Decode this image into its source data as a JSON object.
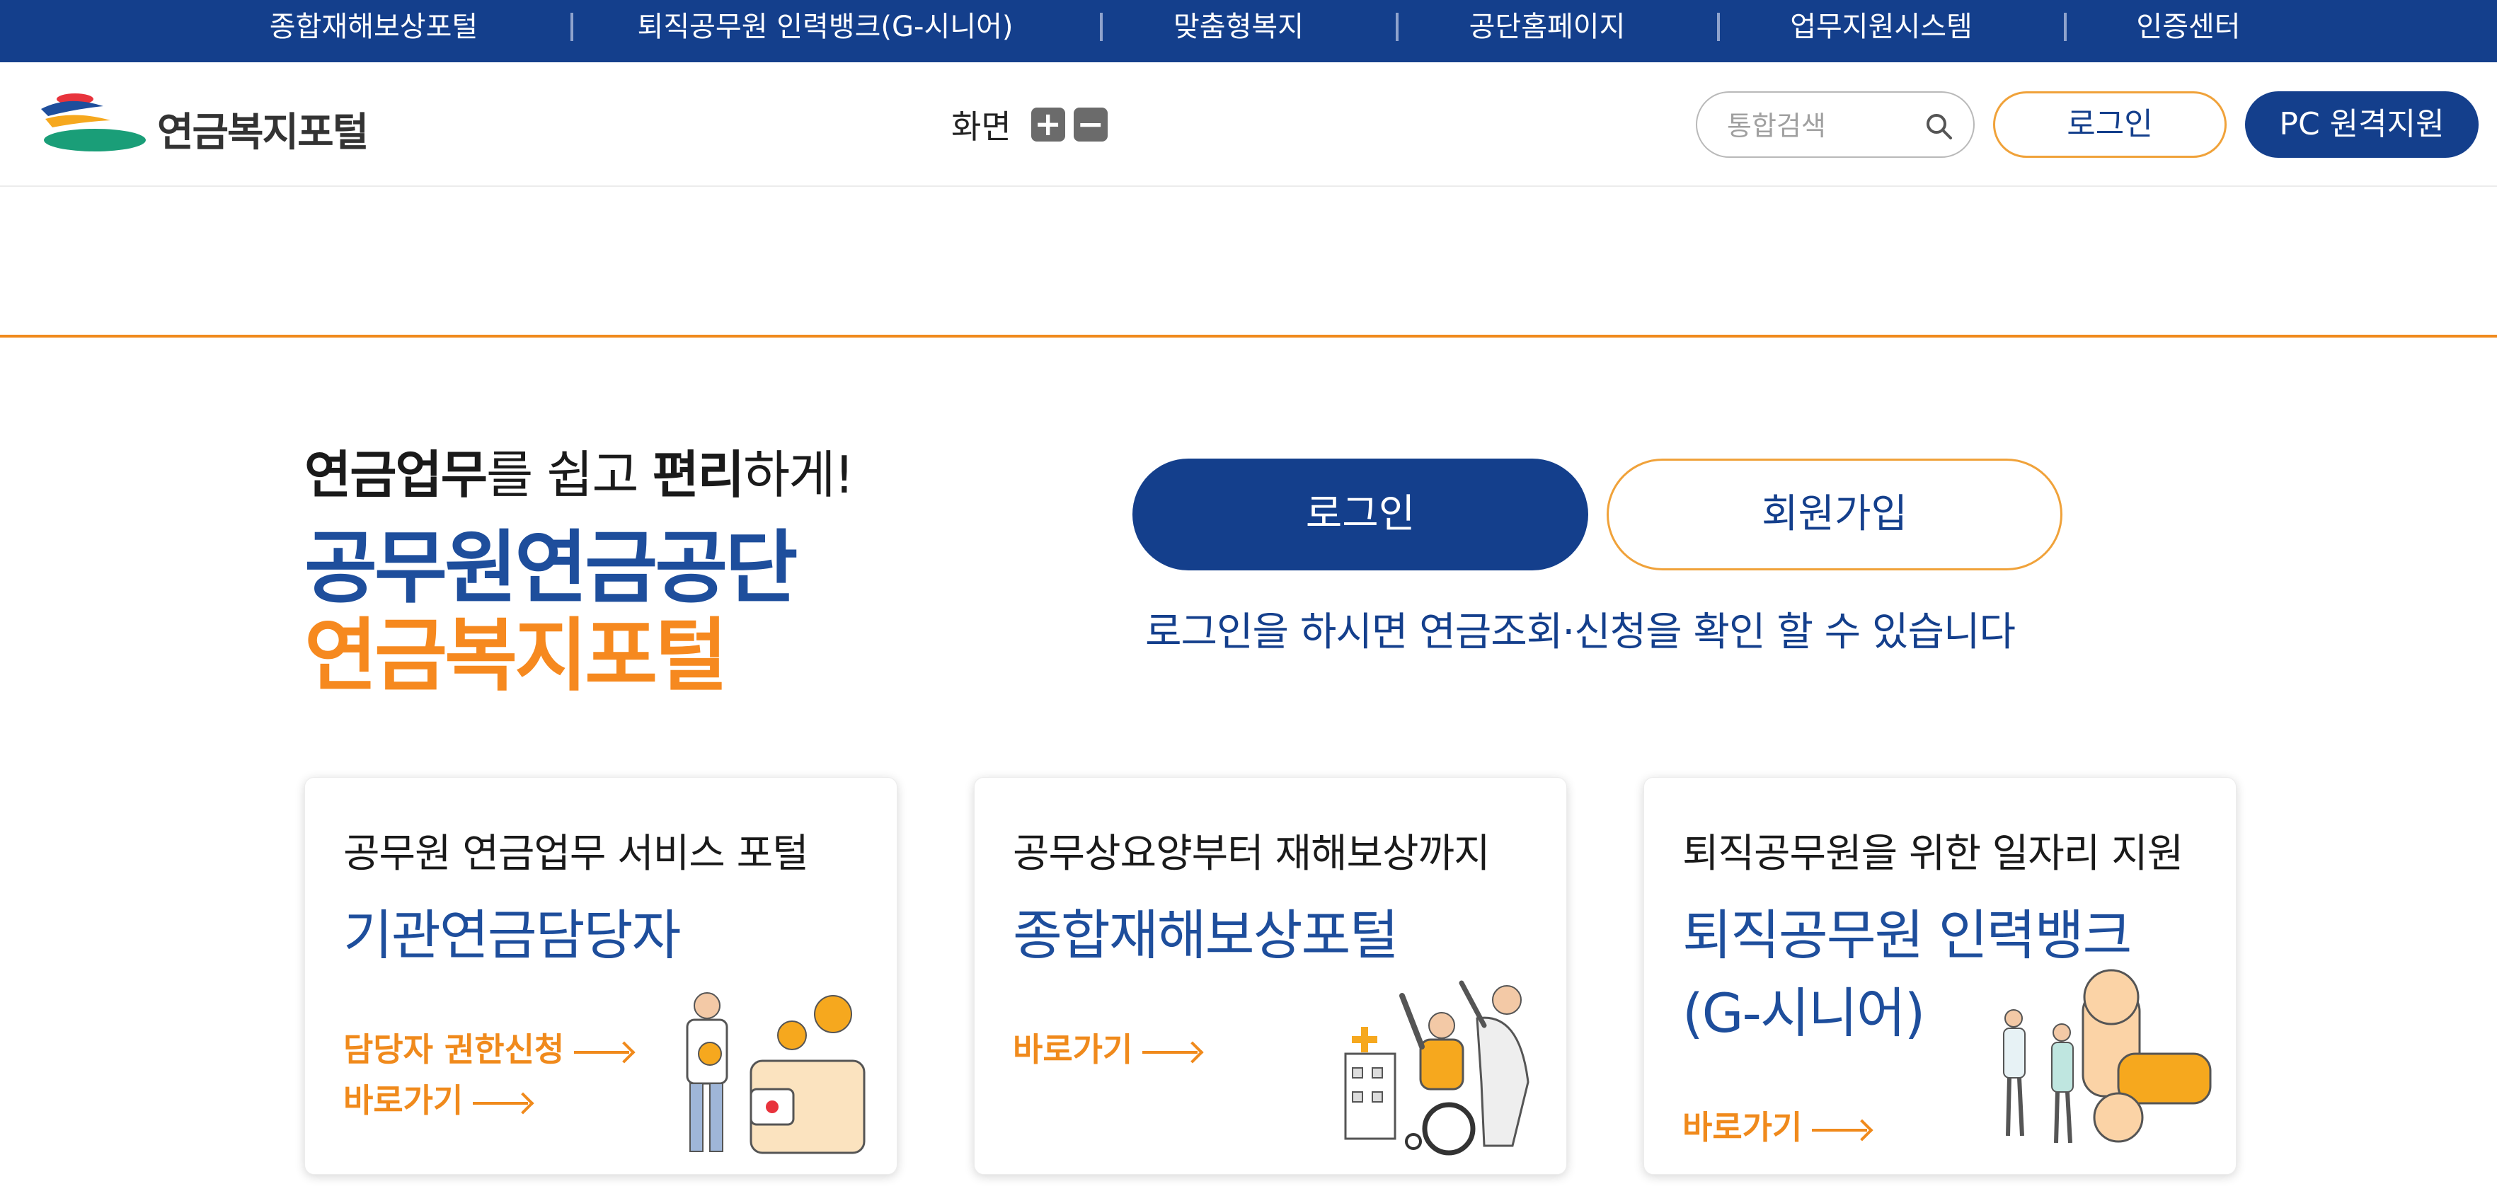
{
  "top_nav": [
    {
      "label": "종합재해보상포털"
    },
    {
      "label": "퇴직공무원 인력뱅크(G-시니어)"
    },
    {
      "label": "맞춤형복지"
    },
    {
      "label": "공단홈페이지"
    },
    {
      "label": "업무지원시스템"
    },
    {
      "label": "인증센터"
    }
  ],
  "header": {
    "logo_text": "연금복지포털",
    "zoom_label": "화면",
    "zoom_in": "+",
    "zoom_out": "−",
    "search_placeholder": "통합검색",
    "login_label": "로그인",
    "remote_label": "PC 원격지원"
  },
  "hero": {
    "tagline_bold1": "연금업무",
    "tagline_mid": "를 쉽고 ",
    "tagline_bold2": "편리",
    "tagline_end": "하게!",
    "brand_line1": "공무원연금공단",
    "brand_line2": "연금복지포털",
    "login_button": "로그인",
    "join_button": "회원가입",
    "login_note": "로그인을 하시면 연금조회·신청을 확인 할 수 있습니다"
  },
  "cards": [
    {
      "title": "공무원 연금업무 서비스 포털",
      "name": "기관연금담당자",
      "links": [
        "담당자 권한신청",
        "바로가기"
      ]
    },
    {
      "title": "공무상요양부터 재해보상까지",
      "name": "종합재해보상포털",
      "links": [
        "바로가기"
      ]
    },
    {
      "title": "퇴직공무원을 위한 일자리 지원",
      "name_line1": "퇴직공무원 인력뱅크",
      "name_line2": "(G-시니어)",
      "links": [
        "바로가기"
      ]
    }
  ],
  "colors": {
    "primary_navy": "#143f8c",
    "brand_blue": "#1e4e9c",
    "accent_orange": "#f08a1c"
  }
}
